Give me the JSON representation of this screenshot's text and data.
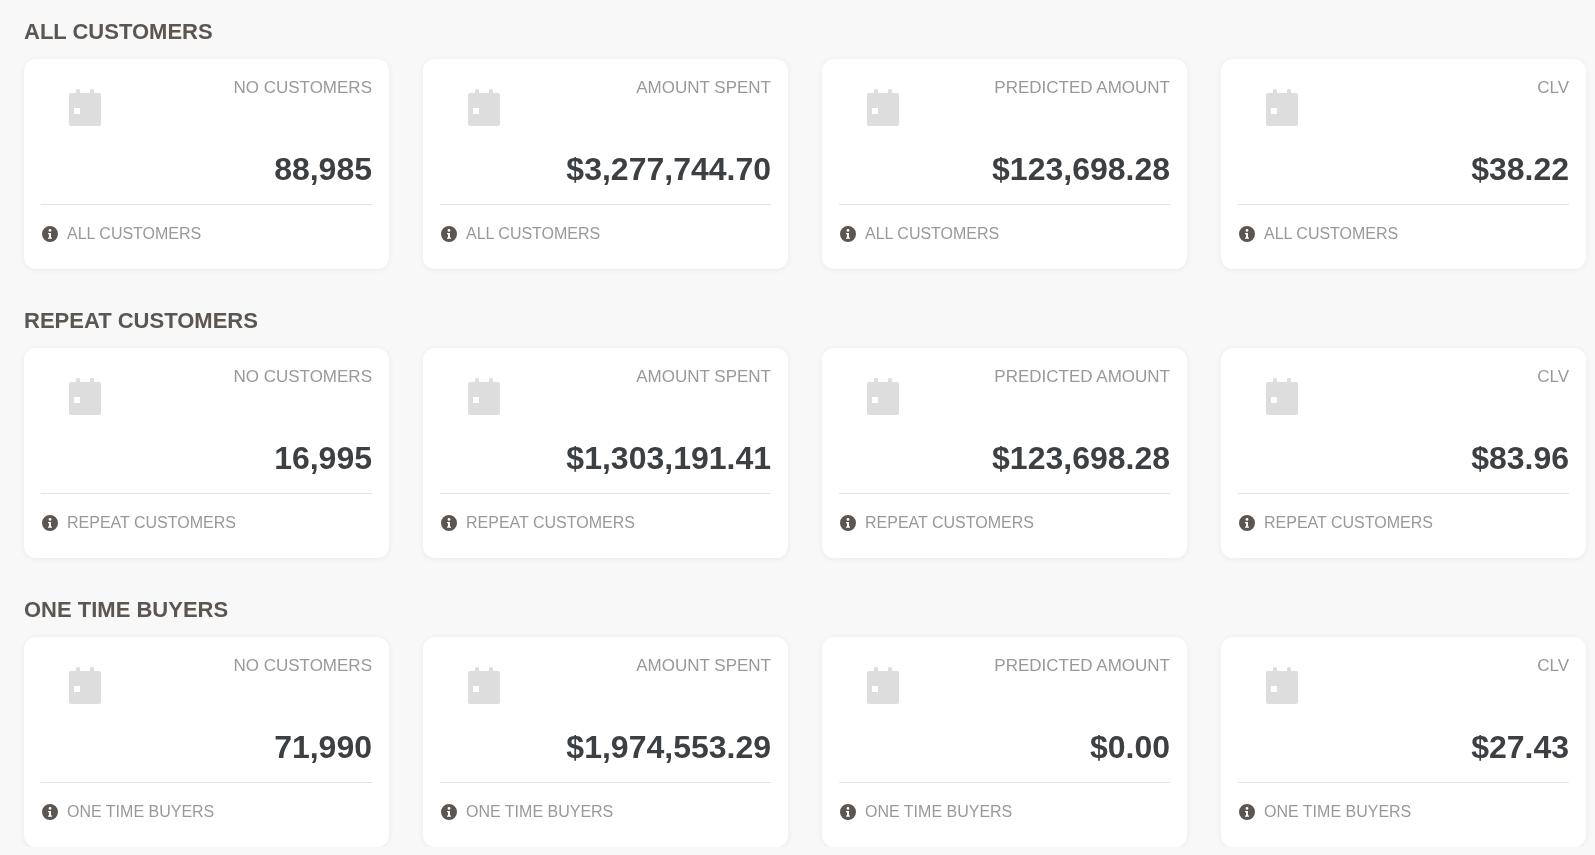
{
  "sections": [
    {
      "title": "ALL CUSTOMERS",
      "cards": [
        {
          "label": "NO CUSTOMERS",
          "value": "88,985",
          "footer": "ALL CUSTOMERS"
        },
        {
          "label": "AMOUNT SPENT",
          "value": "$3,277,744.70",
          "footer": "ALL CUSTOMERS"
        },
        {
          "label": "PREDICTED AMOUNT",
          "value": "$123,698.28",
          "footer": "ALL CUSTOMERS"
        },
        {
          "label": "CLV",
          "value": "$38.22",
          "footer": "ALL CUSTOMERS"
        }
      ]
    },
    {
      "title": "REPEAT CUSTOMERS",
      "cards": [
        {
          "label": "NO CUSTOMERS",
          "value": "16,995",
          "footer": "REPEAT CUSTOMERS"
        },
        {
          "label": "AMOUNT SPENT",
          "value": "$1,303,191.41",
          "footer": "REPEAT CUSTOMERS"
        },
        {
          "label": "PREDICTED AMOUNT",
          "value": "$123,698.28",
          "footer": "REPEAT CUSTOMERS"
        },
        {
          "label": "CLV",
          "value": "$83.96",
          "footer": "REPEAT CUSTOMERS"
        }
      ]
    },
    {
      "title": "ONE TIME BUYERS",
      "cards": [
        {
          "label": "NO CUSTOMERS",
          "value": "71,990",
          "footer": "ONE TIME BUYERS"
        },
        {
          "label": "AMOUNT SPENT",
          "value": "$1,974,553.29",
          "footer": "ONE TIME BUYERS"
        },
        {
          "label": "PREDICTED AMOUNT",
          "value": "$0.00",
          "footer": "ONE TIME BUYERS"
        },
        {
          "label": "CLV",
          "value": "$27.43",
          "footer": "ONE TIME BUYERS"
        }
      ]
    }
  ]
}
